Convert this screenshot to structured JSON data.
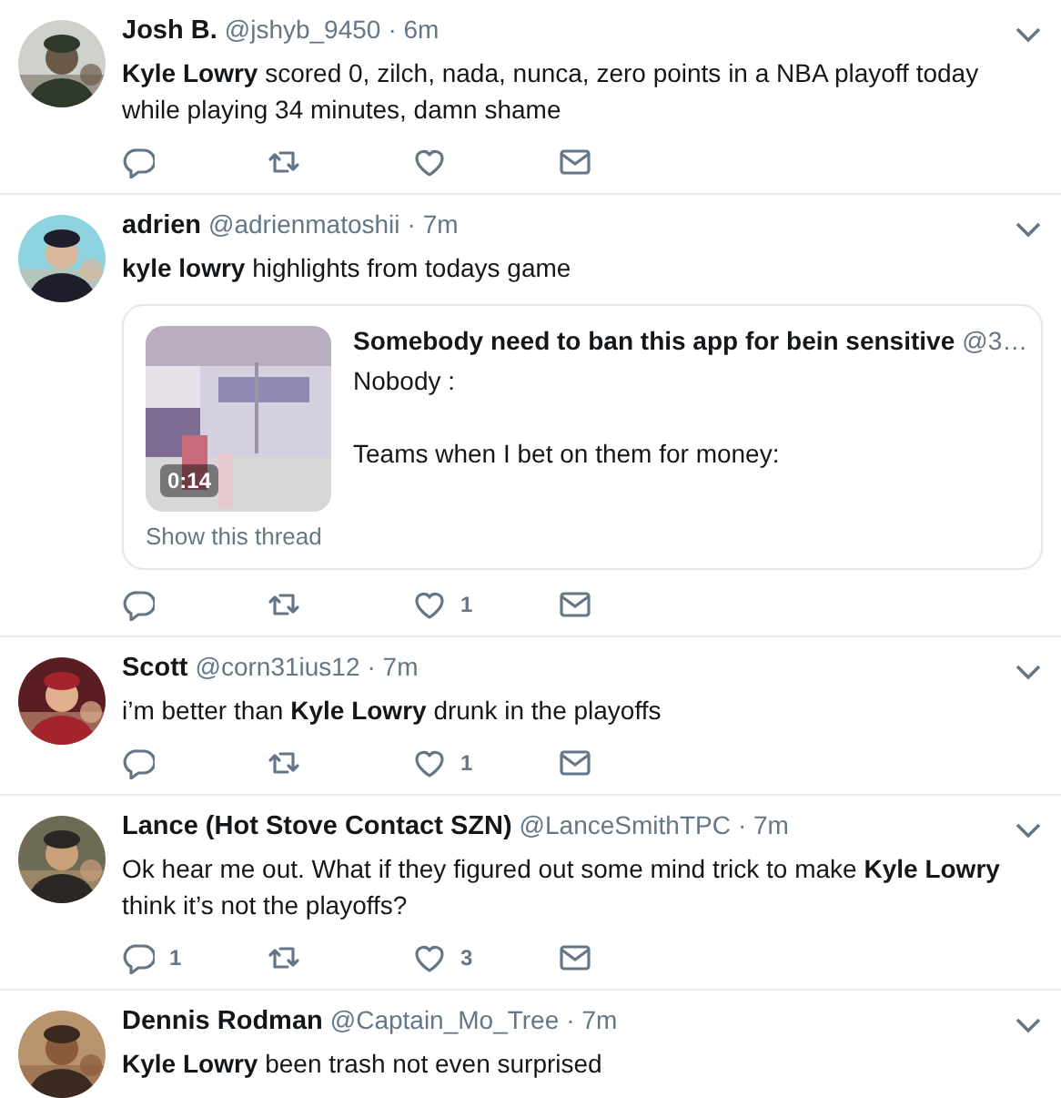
{
  "tweets": [
    {
      "name": "Josh B.",
      "handle": "@jshyb_9450",
      "time": "· 6m",
      "text": "**Kyle Lowry** scored 0, zilch, nada, nunca, zero points in a NBA playoff today while playing 34 minutes, damn shame"
    },
    {
      "name": "adrien",
      "handle": "@adrienmatoshii",
      "time": "· 7m",
      "text": "**kyle lowry** highlights from todays game",
      "quote": {
        "author": "Somebody need to ban this app for bein sensitive",
        "handle": "@3…",
        "lines": [
          "Nobody :",
          "Teams when I bet on them for money:"
        ],
        "duration": "0:14",
        "link": "Show this thread"
      },
      "likes": "1"
    },
    {
      "name": "Scott",
      "handle": "@corn31ius12",
      "time": "· 7m",
      "text": "i’m better than **Kyle Lowry** drunk in the playoffs",
      "likes": "1"
    },
    {
      "name": "Lance (Hot Stove Contact SZN)",
      "handle": "@LanceSmithTPC",
      "time": "· 7m",
      "text": "Ok hear me out. What if they figured out some mind trick to make **Kyle Lowry** think it’s not the playoffs?",
      "replies": "1",
      "likes": "3"
    },
    {
      "name": "Dennis Rodman",
      "handle": "@Captain_Mo_Tree",
      "time": "· 7m",
      "text": "**Kyle Lowry** been trash not even surprised"
    }
  ]
}
